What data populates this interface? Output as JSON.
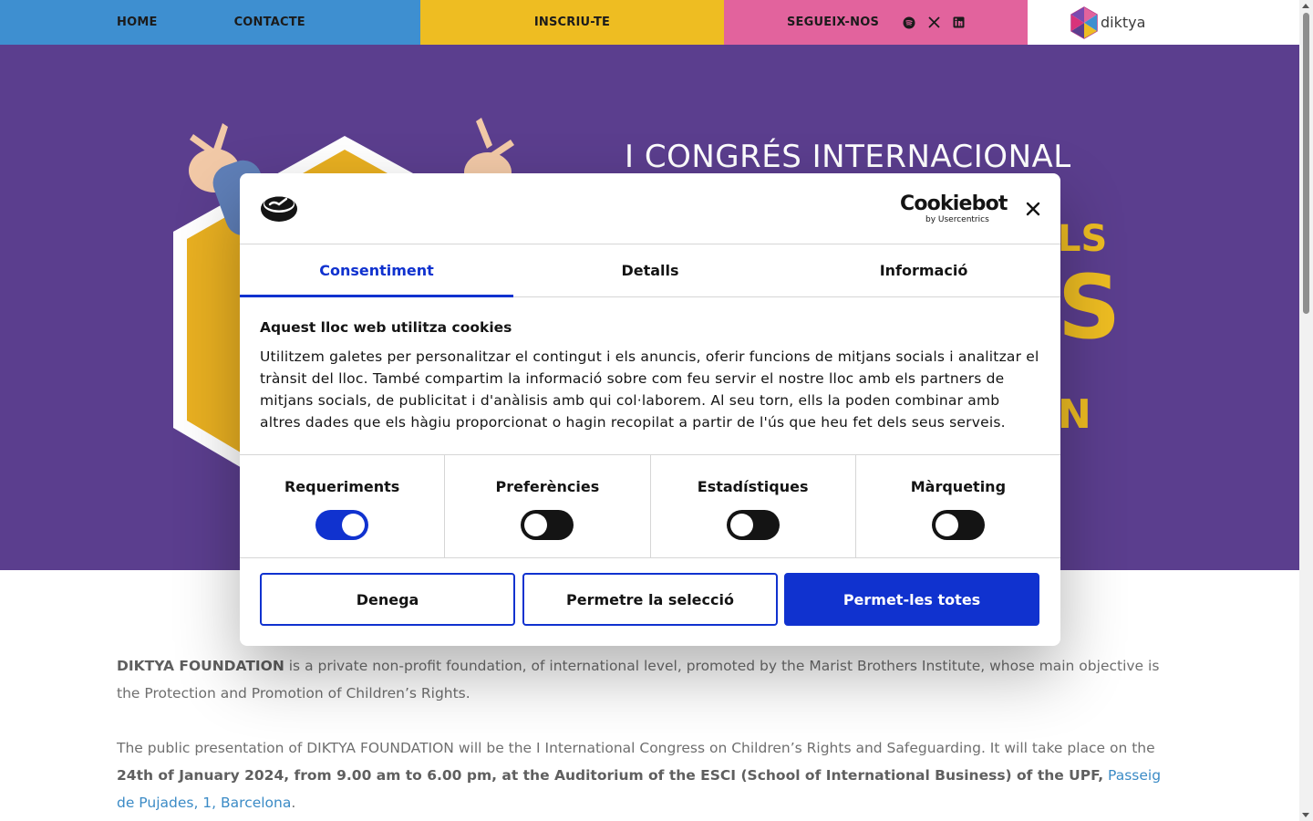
{
  "nav": {
    "home": "HOME",
    "contact": "CONTACTE",
    "signup": "INSCRIU-TE",
    "follow": "SEGUEIX-NOS",
    "social_icons": [
      "spotify-icon",
      "x-icon",
      "linkedin-icon"
    ],
    "logo_text": "diktya",
    "colors": {
      "blue": "#3e8fd0",
      "yellow": "#eebd22",
      "pink": "#e2639d"
    }
  },
  "hero": {
    "title": "I CONGRÉS INTERNACIONAL",
    "background": "#5b3e8e",
    "partial_letters": [
      "LS",
      "S",
      "N"
    ]
  },
  "cookie_dialog": {
    "brand": "Cookiebot",
    "brand_sub": "by Usercentrics",
    "tabs": [
      "Consentiment",
      "Detalls",
      "Informació"
    ],
    "active_tab": "Consentiment",
    "heading": "Aquest lloc web utilitza cookies",
    "body": "Utilitzem galetes per personalitzar el contingut i els anuncis, oferir funcions de mitjans socials i analitzar el trànsit del lloc. També compartim la informació sobre com feu servir el nostre lloc amb els partners de mitjans socials, de publicitat i d'anàlisis amb qui col·laborem. Al seu torn, ells la poden combinar amb altres dades que els hàgiu proporcionat o hagin recopilat a partir de l'ús que heu fet dels seus serveis.",
    "toggles": [
      {
        "label": "Requeriments",
        "on": true
      },
      {
        "label": "Preferències",
        "on": false
      },
      {
        "label": "Estadístiques",
        "on": false
      },
      {
        "label": "Màrqueting",
        "on": false
      }
    ],
    "buttons": {
      "deny": "Denega",
      "allow_selection": "Permetre la selecció",
      "allow_all": "Permet-les totes"
    },
    "accent": "#1032cf"
  },
  "article": {
    "p1_bold": "DIKTYA FOUNDATION",
    "p1_rest": " is a private non-profit foundation, of international level, promoted by the Marist Brothers Institute, whose main objective is the Protection and Promotion of Children’s Rights.",
    "p2_start": "The public presentation of DIKTYA FOUNDATION will be the I International Congress on Children’s Rights and Safeguarding. It will take place on the ",
    "p2_bold": "24th of January 2024, from 9.00 am to 6.00 pm, at the Auditorium of the ESCI (School of International Business) of the UPF,",
    "p2_space": " ",
    "p2_link": "Passeig de Pujades, 1, Barcelona",
    "p2_end": "."
  }
}
